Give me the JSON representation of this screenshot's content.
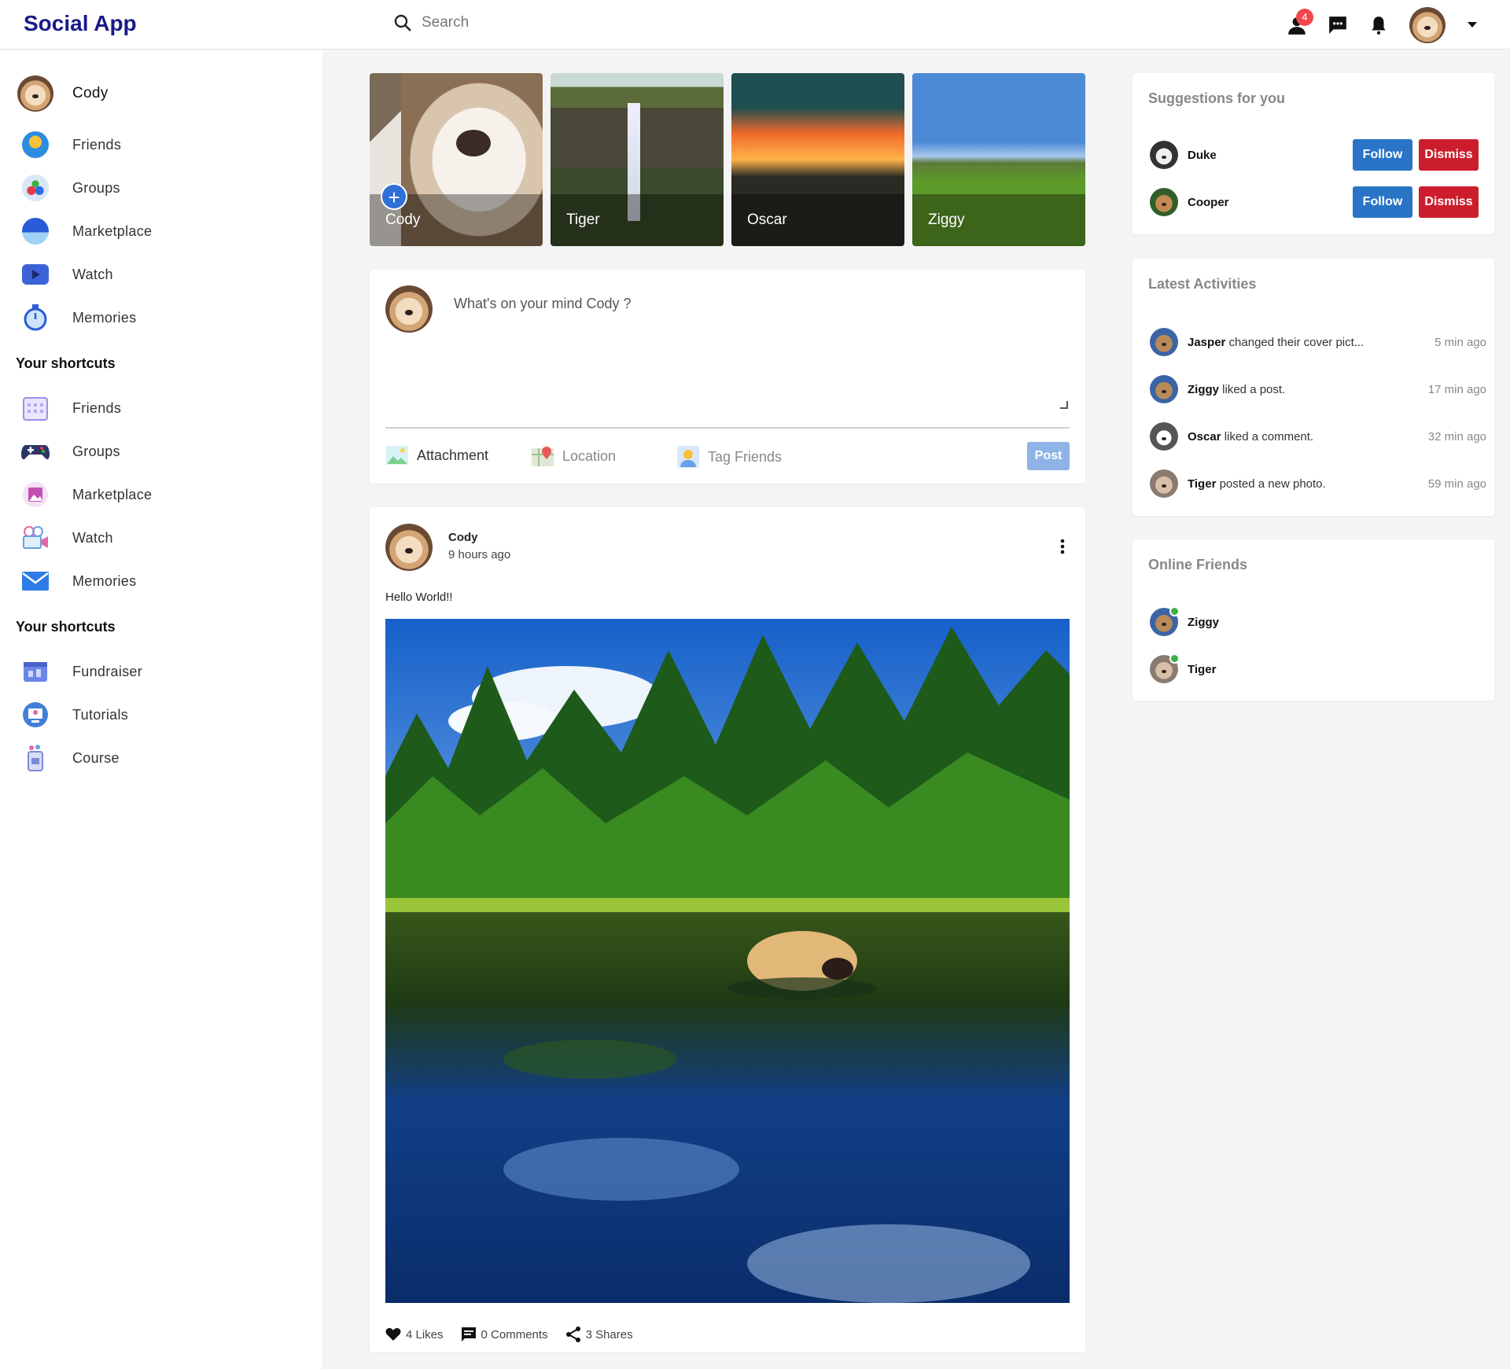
{
  "app": {
    "brand": "Social App"
  },
  "search": {
    "placeholder": "Search"
  },
  "topbar": {
    "friend_requests_count": "4"
  },
  "sidebar": {
    "user": "Cody",
    "main_items": [
      {
        "label": "Friends",
        "icon": "friends-icon"
      },
      {
        "label": "Groups",
        "icon": "groups-icon"
      },
      {
        "label": "Marketplace",
        "icon": "marketplace-icon"
      },
      {
        "label": "Watch",
        "icon": "watch-icon"
      },
      {
        "label": "Memories",
        "icon": "memories-icon"
      }
    ],
    "shortcuts_heading_1": "Your shortcuts",
    "shortcuts_1": [
      {
        "label": "Friends",
        "icon": "calendar-icon"
      },
      {
        "label": "Groups",
        "icon": "gamepad-icon"
      },
      {
        "label": "Marketplace",
        "icon": "gallery-icon"
      },
      {
        "label": "Watch",
        "icon": "video-camera-icon"
      },
      {
        "label": "Memories",
        "icon": "mail-icon"
      }
    ],
    "shortcuts_heading_2": "Your shortcuts",
    "shortcuts_2": [
      {
        "label": "Fundraiser",
        "icon": "fundraiser-icon"
      },
      {
        "label": "Tutorials",
        "icon": "tutorials-icon"
      },
      {
        "label": "Course",
        "icon": "course-icon"
      }
    ]
  },
  "stories": [
    {
      "name": "Cody"
    },
    {
      "name": "Tiger"
    },
    {
      "name": "Oscar"
    },
    {
      "name": "Ziggy"
    }
  ],
  "composer": {
    "prompt": "What's on your mind Cody ?",
    "attachment": "Attachment",
    "location": "Location",
    "tag_friends": "Tag Friends",
    "post_button": "Post"
  },
  "post": {
    "author": "Cody",
    "time": "9 hours ago",
    "text": "Hello World!!",
    "likes": "4 Likes",
    "comments": "0 Comments",
    "shares": "3 Shares"
  },
  "suggestions": {
    "title": "Suggestions for you",
    "follow_label": "Follow",
    "dismiss_label": "Dismiss",
    "people": [
      {
        "name": "Duke"
      },
      {
        "name": "Cooper"
      }
    ]
  },
  "activities": {
    "title": "Latest Activities",
    "items": [
      {
        "name": "Jasper",
        "action": "changed their cover pict...",
        "time": "5 min ago"
      },
      {
        "name": "Ziggy",
        "action": "liked a post.",
        "time": "17 min ago"
      },
      {
        "name": "Oscar",
        "action": "liked a comment.",
        "time": "32 min ago"
      },
      {
        "name": "Tiger",
        "action": "posted a new photo.",
        "time": "59 min ago"
      }
    ]
  },
  "online": {
    "title": "Online Friends",
    "friends": [
      {
        "name": "Ziggy"
      },
      {
        "name": "Tiger"
      }
    ]
  }
}
